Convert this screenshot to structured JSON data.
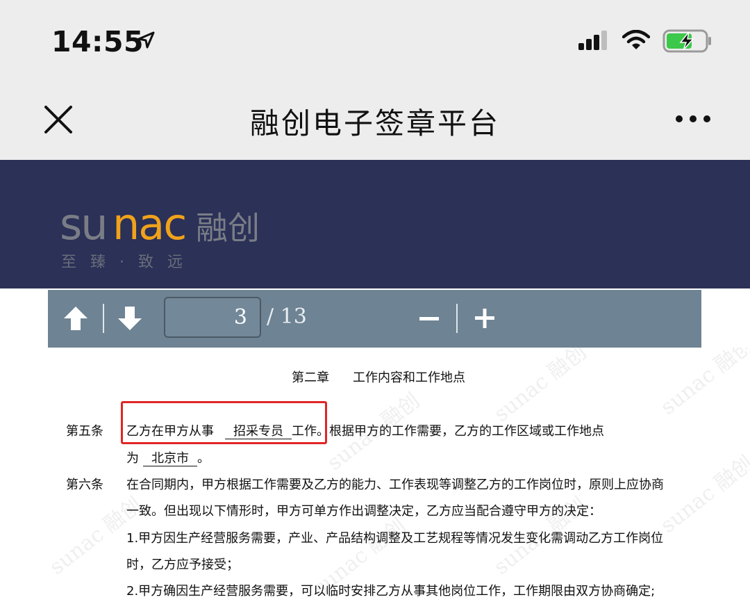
{
  "status_bar": {
    "time": "14:55",
    "icons": [
      "location-arrow-icon",
      "cellular-signal-icon",
      "wifi-icon",
      "battery-charging-icon"
    ]
  },
  "nav": {
    "title": "融创电子签章平台",
    "close_icon": "close-icon",
    "more_icon": "more-dots-icon"
  },
  "banner": {
    "logo_brand": "sunac",
    "logo_cn": "融创",
    "logo_slogan": "至 臻 · 致 远",
    "background": "#2b3157",
    "accent": "#f0a21b"
  },
  "pdf_toolbar": {
    "current_page": "3",
    "total_pages": "/ 13",
    "prev_icon": "arrow-up-icon",
    "next_icon": "arrow-down-icon",
    "zoom_out_icon": "minus-icon",
    "zoom_in_icon": "plus-icon"
  },
  "document": {
    "chapter": "第二章",
    "chapter_title": "工作内容和工作地点",
    "art5_label": "第五条",
    "art5_line1_a": "乙方在甲方从事",
    "art5_position": "招采专员",
    "art5_line1_b": "工作。根据甲方的工作需要，乙方的工作区域或工作地点",
    "art5_line2_a": "为",
    "art5_city": "北京市",
    "art5_line2_b": "。",
    "art6_label": "第六条",
    "art6_line1": "在合同期内，甲方根据工作需要及乙方的能力、工作表现等调整乙方的工作岗位时，原则上应协商",
    "art6_line2": "一致。但出现以下情形时，甲方可单方作出调整决定，乙方应当配合遵守甲方的决定：",
    "art6_line3": "1.甲方因生产经营服务需要，产业、产品结构调整及工艺规程等情况发生变化需调动乙方工作岗位",
    "art6_line4": "时，乙方应予接受；",
    "art6_line5": "2.甲方确因生产经营服务需要，可以临时安排乙方从事其他岗位工作，工作期限由双方协商确定;",
    "watermark": "sunac 融创",
    "highlight_color": "#e02525"
  }
}
